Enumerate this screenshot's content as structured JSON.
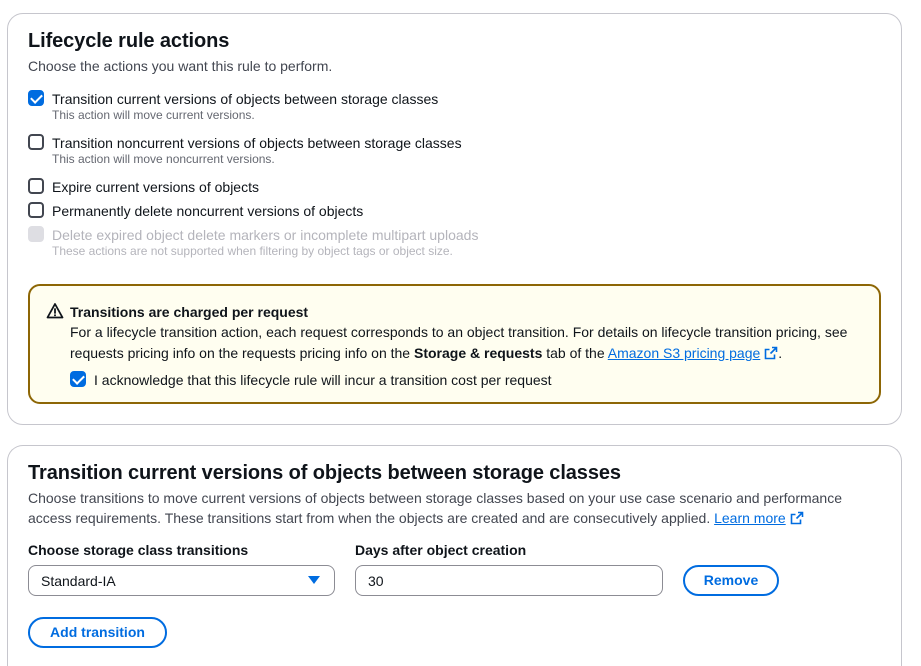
{
  "actions_section": {
    "title": "Lifecycle rule actions",
    "description": "Choose the actions you want this rule to perform.",
    "options": [
      {
        "label": "Transition current versions of objects between storage classes",
        "sub": "This action will move current versions.",
        "checked": true,
        "disabled": false
      },
      {
        "label": "Transition noncurrent versions of objects between storage classes",
        "sub": "This action will move noncurrent versions.",
        "checked": false,
        "disabled": false
      },
      {
        "label": "Expire current versions of objects",
        "sub": "",
        "checked": false,
        "disabled": false
      },
      {
        "label": "Permanently delete noncurrent versions of objects",
        "sub": "",
        "checked": false,
        "disabled": false
      },
      {
        "label": "Delete expired object delete markers or incomplete multipart uploads",
        "sub": "These actions are not supported when filtering by object tags or object size.",
        "checked": false,
        "disabled": true
      }
    ],
    "alert": {
      "title": "Transitions are charged per request",
      "body_prefix": "For a lifecycle transition action, each request corresponds to an object transition. For details on lifecycle transition pricing, see requests pricing info on the requests pricing info on the ",
      "body_bold": "Storage & requests",
      "body_middle": " tab of the ",
      "link_text": "Amazon S3 pricing page",
      "body_suffix": ".",
      "acknowledge_label": "I acknowledge that this lifecycle rule will incur a transition cost per request",
      "acknowledged": true,
      "icon": "warning-icon"
    }
  },
  "transition_section": {
    "title": "Transition current versions of objects between storage classes",
    "description": "Choose transitions to move current versions of objects between storage classes based on your use case scenario and performance access requirements. These transitions start from when the objects are created and are consecutively applied.",
    "learn_more": "Learn more",
    "storage_class_label": "Choose storage class transitions",
    "storage_class_value": "Standard-IA",
    "days_label": "Days after object creation",
    "days_value": "30",
    "remove_label": "Remove",
    "add_label": "Add transition"
  },
  "colors": {
    "accent": "#006ce0",
    "warning_border": "#8d6605",
    "warning_bg": "#fffef0",
    "disabled": "#b4b4bb"
  }
}
